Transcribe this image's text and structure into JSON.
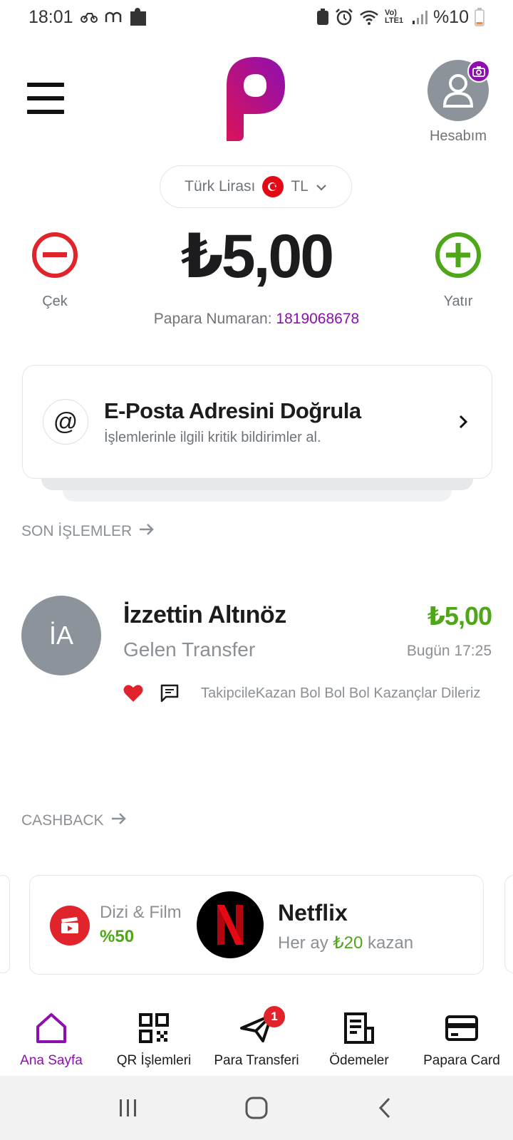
{
  "status_bar": {
    "time": "18:01",
    "battery_text": "%10",
    "network_text": "Vo) LTE1"
  },
  "header": {
    "account_label": "Hesabım"
  },
  "currency": {
    "name": "Türk Lirası",
    "code": "TL"
  },
  "balance": {
    "amount": "₺5,00",
    "papara_number_label": "Papara Numaran:",
    "papara_number": "1819068678",
    "withdraw_label": "Çek",
    "deposit_label": "Yatır"
  },
  "verify_card": {
    "title": "E-Posta Adresini Doğrula",
    "subtitle": "İşlemlerinle ilgili kritik bildirimler al."
  },
  "recent": {
    "title": "SON İŞLEMLER",
    "items": [
      {
        "initials": "İA",
        "name": "İzzettin Altınöz",
        "type": "Gelen Transfer",
        "amount": "₺5,00",
        "time": "Bugün 17:25",
        "note": "TakipcileKazan Bol Bol Bol Kazançlar Dileriz"
      }
    ]
  },
  "cashback": {
    "title": "CASHBACK",
    "card": {
      "category": "Dizi & Film",
      "percent": "%50",
      "brand": "Netflix",
      "offer_prefix": "Her ay",
      "offer_amount": "₺20",
      "offer_suffix": "kazan"
    }
  },
  "bottom_nav": {
    "items": [
      {
        "label": "Ana Sayfa",
        "icon": "home-icon",
        "active": true
      },
      {
        "label": "QR İşlemleri",
        "icon": "qr-icon"
      },
      {
        "label": "Para Transferi",
        "icon": "send-icon",
        "badge": "1"
      },
      {
        "label": "Ödemeler",
        "icon": "receipt-icon"
      },
      {
        "label": "Papara Card",
        "icon": "card-icon"
      }
    ]
  },
  "colors": {
    "brand_purple": "#8e0fb0",
    "green": "#4ea719",
    "red": "#e1232b"
  }
}
